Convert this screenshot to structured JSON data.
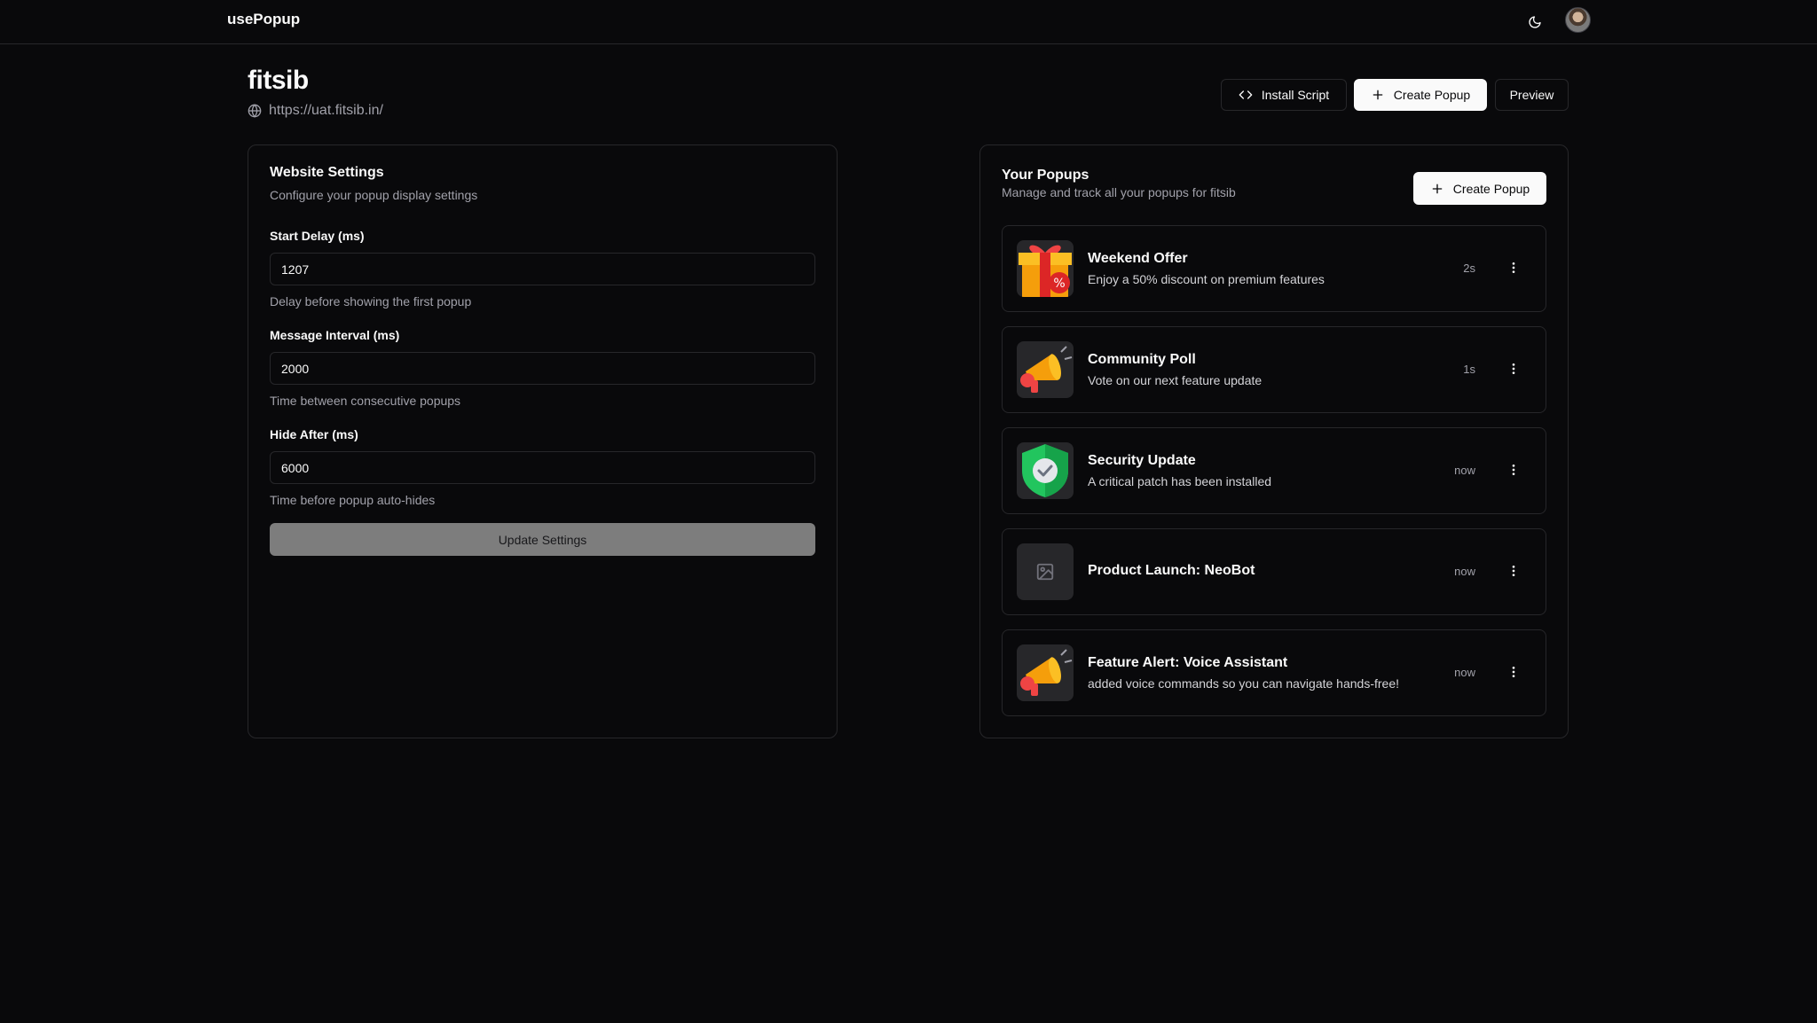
{
  "app": {
    "brand": "usePopup"
  },
  "site": {
    "name": "fitsib",
    "url": "https://uat.fitsib.in/"
  },
  "header_actions": {
    "install_script": "Install Script",
    "create_popup": "Create Popup",
    "preview": "Preview"
  },
  "settings": {
    "title": "Website Settings",
    "description": "Configure your popup display settings",
    "fields": [
      {
        "label": "Start Delay (ms)",
        "value": "1207",
        "help": "Delay before showing the first popup"
      },
      {
        "label": "Message Interval (ms)",
        "value": "2000",
        "help": "Time between consecutive popups"
      },
      {
        "label": "Hide After (ms)",
        "value": "6000",
        "help": "Time before popup auto-hides"
      }
    ],
    "submit_label": "Update Settings"
  },
  "popups": {
    "title": "Your Popups",
    "description": "Manage and track all your popups for fitsib",
    "create_label": "Create Popup",
    "items": [
      {
        "name": "Weekend Offer",
        "description": "Enjoy a 50% discount on premium features",
        "time": "2s",
        "icon": "gift-icon"
      },
      {
        "name": "Community Poll",
        "description": "Vote on our next feature update",
        "time": "1s",
        "icon": "megaphone-icon"
      },
      {
        "name": "Security Update",
        "description": "A critical patch has been installed",
        "time": "now",
        "icon": "shield-check-icon"
      },
      {
        "name": "Product Launch: NeoBot",
        "description": "",
        "time": "now",
        "icon": "image-placeholder-icon"
      },
      {
        "name": "Feature Alert: Voice Assistant",
        "description": "added voice commands so you can navigate hands-free!",
        "time": "now",
        "icon": "megaphone-icon"
      }
    ]
  },
  "colors": {
    "background": "#09090b",
    "border": "#27272a",
    "muted_text": "#a1a1aa",
    "primary_button": "#fafafa",
    "disabled_button": "#7d7d7d",
    "shield_green": "#22c55e",
    "gift_orange": "#f59e0b",
    "gift_red": "#dc2626"
  }
}
